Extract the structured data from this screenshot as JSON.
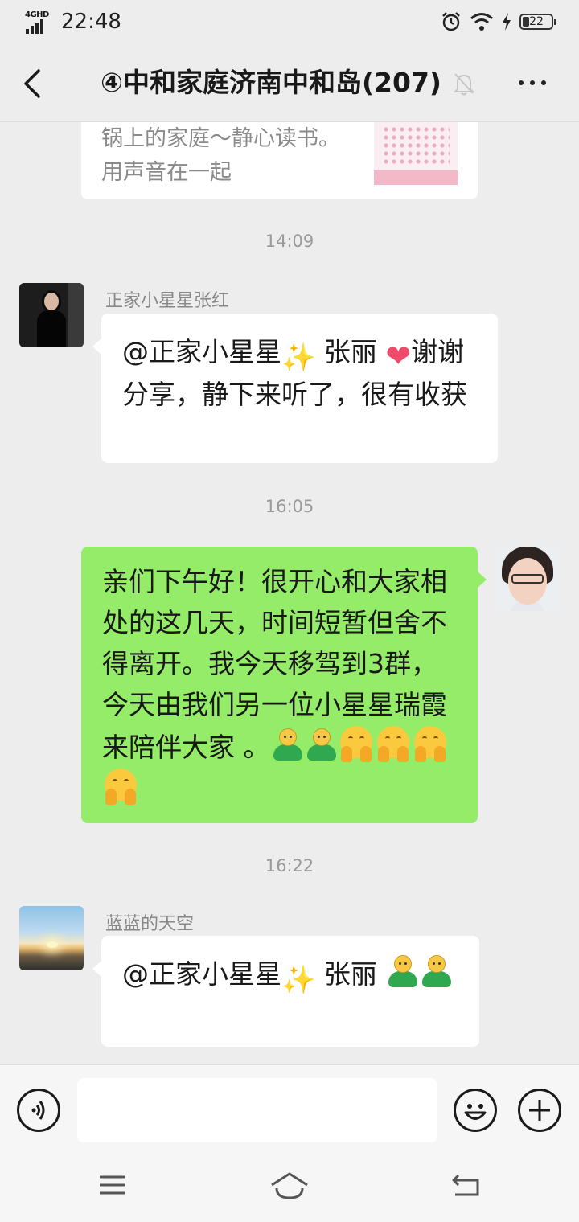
{
  "status_bar": {
    "network": "4GHD",
    "time": "22:48",
    "battery": "22",
    "icons": [
      "signal-icon",
      "alarm-icon",
      "wifi-icon",
      "charging-icon",
      "battery-icon"
    ]
  },
  "header": {
    "title": "④中和家庭济南中和岛(207)",
    "back_icon": "chevron-left-icon",
    "mute_icon": "bell-off-icon",
    "more_icon": "more-dots-icon"
  },
  "messages": {
    "link_card": {
      "desc": "锅上的家庭～静心读书。用声音在一起"
    },
    "time1": "14:09",
    "msg1": {
      "sender": "正家小星星张红",
      "text_a": "@正家小星星",
      "text_b": " 张丽 ",
      "text_c": "谢谢分享，静下来听了，很有收获",
      "emoji_sparkle": "✨",
      "emoji_heart": "❤"
    },
    "time2": "16:05",
    "msg2": {
      "text": "亲们下午好！很开心和大家相处的这几天，时间短暂但舍不得离开。我今天移驾到3群，今天由我们另一位小星星瑞霞来陪伴大家 。"
    },
    "time3": "16:22",
    "msg3": {
      "sender": "蓝蓝的天空",
      "text_a": "@正家小星星",
      "text_b": " 张丽 ",
      "emoji_sparkle": "✨"
    }
  },
  "input_bar": {
    "value": "",
    "icons": [
      "voice-icon",
      "emoji-icon",
      "plus-icon"
    ]
  },
  "system_nav": {
    "icons": [
      "menu-icon",
      "home-icon",
      "back-icon"
    ]
  }
}
